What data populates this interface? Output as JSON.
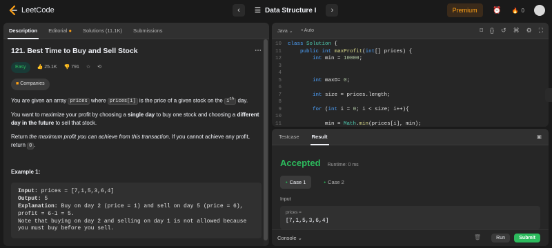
{
  "app": {
    "name": "LeetCode",
    "nav_title": "Data Structure I",
    "premium_label": "Premium",
    "streak_count": "0"
  },
  "left_tabs": [
    {
      "label": "Description"
    },
    {
      "label": "Editorial"
    },
    {
      "label": "Solutions (11.1K)"
    },
    {
      "label": "Submissions"
    }
  ],
  "problem": {
    "title": "121. Best Time to Buy and Sell Stock",
    "difficulty": "Easy",
    "likes": "25.1K",
    "dislikes": "791",
    "companies_label": "Companies",
    "p1_a": "You are given an array ",
    "p1_code1": "prices",
    "p1_b": " where ",
    "p1_code2": "prices[i]",
    "p1_c": " is the price of a given stock on the ",
    "p1_code3": "i",
    "p1_sup": "th",
    "p1_d": " day.",
    "p2_a": "You want to maximize your profit by choosing a ",
    "p2_b": "single day",
    "p2_c": " to buy one stock and choosing a ",
    "p2_d": "different day in the future",
    "p2_e": " to sell that stock.",
    "p3_a": "Return ",
    "p3_b": "the maximum profit you can achieve from this transaction",
    "p3_c": ". If you cannot achieve any profit, return ",
    "p3_code": "0",
    "p3_d": ".",
    "example_title": "Example 1:",
    "example_input_label": "Input:",
    "example_input": " prices = [7,1,5,3,6,4]",
    "example_output_label": "Output:",
    "example_output": " 5",
    "example_expl_label": "Explanation:",
    "example_expl": " Buy on day 2 (price = 1) and sell on day 5 (price = 6), profit = 6-1 = 5.",
    "example_note": "Note that buying on day 2 and selling on day 1 is not allowed because you must buy before you sell."
  },
  "editor": {
    "language": "Java",
    "mode": "Auto",
    "code_lines": [
      {
        "n": "10",
        "code": "class Solution {"
      },
      {
        "n": "11",
        "code": "    public int maxProfit(int[] prices) {"
      },
      {
        "n": "12",
        "code": "        int min = 10000;"
      },
      {
        "n": "3",
        "code": ""
      },
      {
        "n": "4",
        "code": ""
      },
      {
        "n": "5",
        "code": "        int maxD= 0;"
      },
      {
        "n": "6",
        "code": ""
      },
      {
        "n": "7",
        "code": "        int size = prices.length;"
      },
      {
        "n": "8",
        "code": ""
      },
      {
        "n": "9",
        "code": "        for (int i = 0; i < size; i++){"
      },
      {
        "n": "10",
        "code": ""
      },
      {
        "n": "11",
        "code": "            min = Math.min(prices[i], min);"
      }
    ]
  },
  "result": {
    "tabs": [
      {
        "label": "Testcase"
      },
      {
        "label": "Result"
      }
    ],
    "status": "Accepted",
    "runtime": "Runtime: 0 ms",
    "cases": [
      {
        "label": "Case 1"
      },
      {
        "label": "Case 2"
      }
    ],
    "input_label": "Input",
    "input_name": "prices =",
    "input_value": "[7,1,5,3,6,4]",
    "console_label": "Console",
    "run_label": "Run",
    "submit_label": "Submit"
  }
}
